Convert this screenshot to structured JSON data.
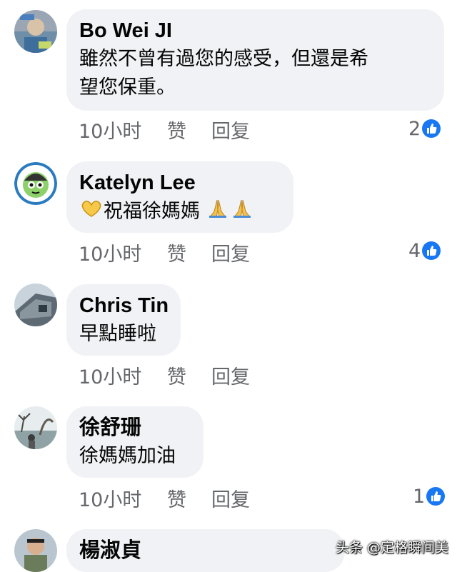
{
  "comments": [
    {
      "author": "Bo Wei JI",
      "text_line1": "雖然不曾有過您的感受，但還是希",
      "text_line2": "望您保重。",
      "time": "10小时",
      "like_label": "赞",
      "reply_label": "回复",
      "reaction_count": "2",
      "avatar_icon": "avatar-photo"
    },
    {
      "author": "Katelyn Lee",
      "text": "祝福徐媽媽",
      "time": "10小时",
      "like_label": "赞",
      "reply_label": "回复",
      "reaction_count": "4",
      "avatar_icon": "cartoon-avatar",
      "emoji_prefix": "heart-hands-emoji",
      "emoji_suffix": "folded-hands-emoji"
    },
    {
      "author": "Chris Tin",
      "text": "早點睡啦",
      "time": "10小时",
      "like_label": "赞",
      "reply_label": "回复",
      "avatar_icon": "building-photo-avatar"
    },
    {
      "author": "徐舒珊",
      "text": "徐媽媽加油",
      "time": "10小时",
      "like_label": "赞",
      "reply_label": "回复",
      "reaction_count": "1",
      "avatar_icon": "landscape-photo-avatar"
    },
    {
      "author": "楊淑貞",
      "avatar_icon": "person-photo-avatar"
    }
  ],
  "watermark": "头条 @定格瞬间美",
  "colors": {
    "bubble": "#f0f2f5",
    "meta_text": "#65676b",
    "like_blue": "#1877f2",
    "name_text": "#050505"
  }
}
